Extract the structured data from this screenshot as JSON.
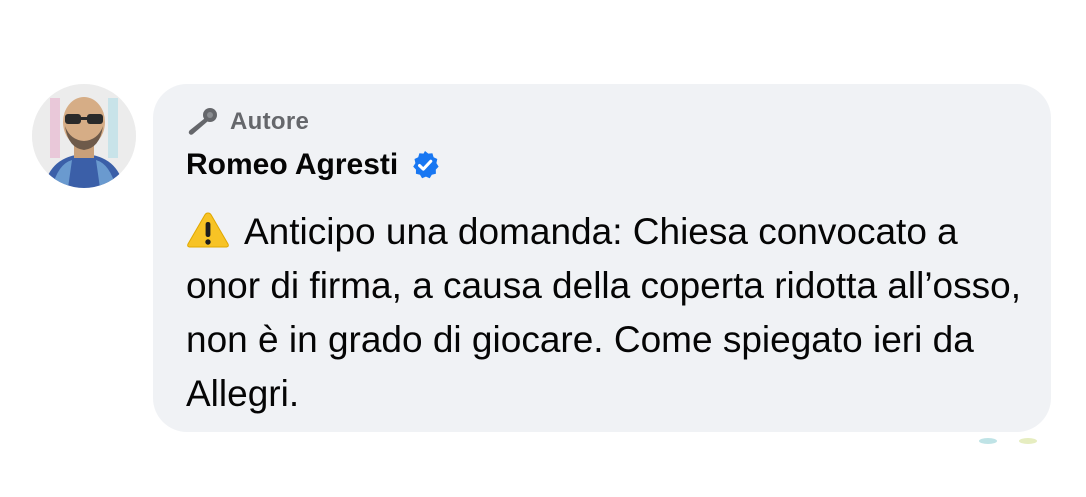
{
  "comment": {
    "badge": {
      "icon": "microphone-icon",
      "label": "Autore"
    },
    "author": {
      "name": "Romeo Agresti",
      "verified_icon": "verified-check-icon",
      "avatar_icon": "avatar"
    },
    "text_icon": "warning-icon",
    "text": "Anticipo una domanda: Chiesa convocato a onor di firma, a causa della coperta ridotta all’osso, non è in grado di giocare. Come spiegato ieri da Allegri."
  },
  "colors": {
    "bubble_background": "#f0f2f5",
    "text_primary": "#050505",
    "text_secondary": "#65676b",
    "verified_blue": "#1877f2",
    "warning_yellow": "#f7c325"
  }
}
